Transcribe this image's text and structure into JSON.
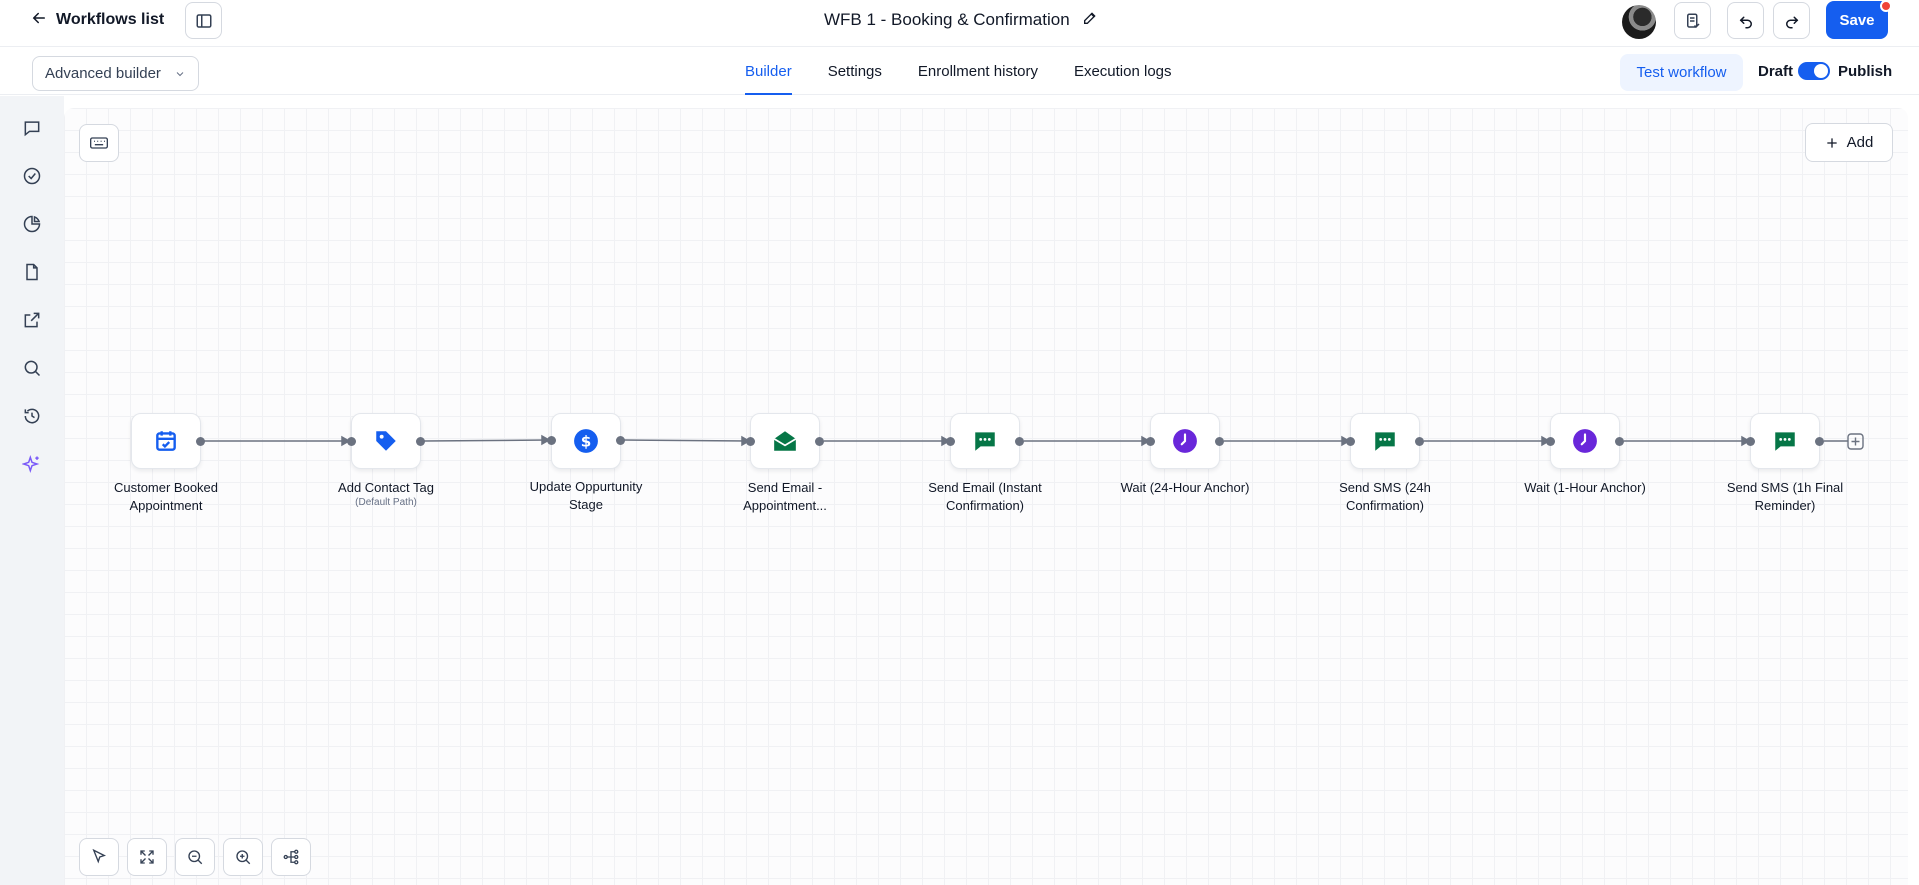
{
  "topbar": {
    "back_label": "Workflows list",
    "workflow_title": "WFB 1 - Booking & Confirmation",
    "save_label": "Save"
  },
  "subbar": {
    "builder_mode": "Advanced builder",
    "tabs": [
      {
        "label": "Builder",
        "active": true
      },
      {
        "label": "Settings",
        "active": false
      },
      {
        "label": "Enrollment history",
        "active": false
      },
      {
        "label": "Execution logs",
        "active": false
      }
    ],
    "test_label": "Test workflow",
    "draft_label": "Draft",
    "publish_label": "Publish",
    "publish_toggle_on": true
  },
  "canvas": {
    "add_label": "Add",
    "nodes": [
      {
        "label_line1": "Customer Booked",
        "label_line2": "Appointment",
        "sublabel": "",
        "icon": "calendar-check-icon",
        "color": "#155eef"
      },
      {
        "label_line1": "Add Contact Tag",
        "label_line2": "",
        "sublabel": "(Default Path)",
        "icon": "tag-icon",
        "color": "#155eef"
      },
      {
        "label_line1": "Update Oppurtunity",
        "label_line2": "Stage",
        "sublabel": "",
        "icon": "dollar-icon",
        "color": "#155eef"
      },
      {
        "label_line1": "Send Email -",
        "label_line2": "Appointment...",
        "sublabel": "",
        "icon": "envelope-open-icon",
        "color": "#067647"
      },
      {
        "label_line1": "Send Email (Instant",
        "label_line2": "Confirmation)",
        "sublabel": "",
        "icon": "chat-icon",
        "color": "#067647"
      },
      {
        "label_line1": "Wait (24-Hour Anchor)",
        "label_line2": "",
        "sublabel": "",
        "icon": "clock-icon",
        "color": "#6927da"
      },
      {
        "label_line1": "Send SMS (24h",
        "label_line2": "Confirmation)",
        "sublabel": "",
        "icon": "chat-icon",
        "color": "#067647"
      },
      {
        "label_line1": "Wait (1-Hour Anchor)",
        "label_line2": "",
        "sublabel": "",
        "icon": "clock-icon",
        "color": "#6927da"
      },
      {
        "label_line1": "Send SMS (1h Final",
        "label_line2": "Reminder)",
        "sublabel": "",
        "icon": "chat-icon",
        "color": "#067647"
      }
    ]
  },
  "colors": {
    "accent": "#155eef",
    "green": "#067647",
    "purple": "#6927da",
    "ai_purple": "#7a5af8"
  }
}
